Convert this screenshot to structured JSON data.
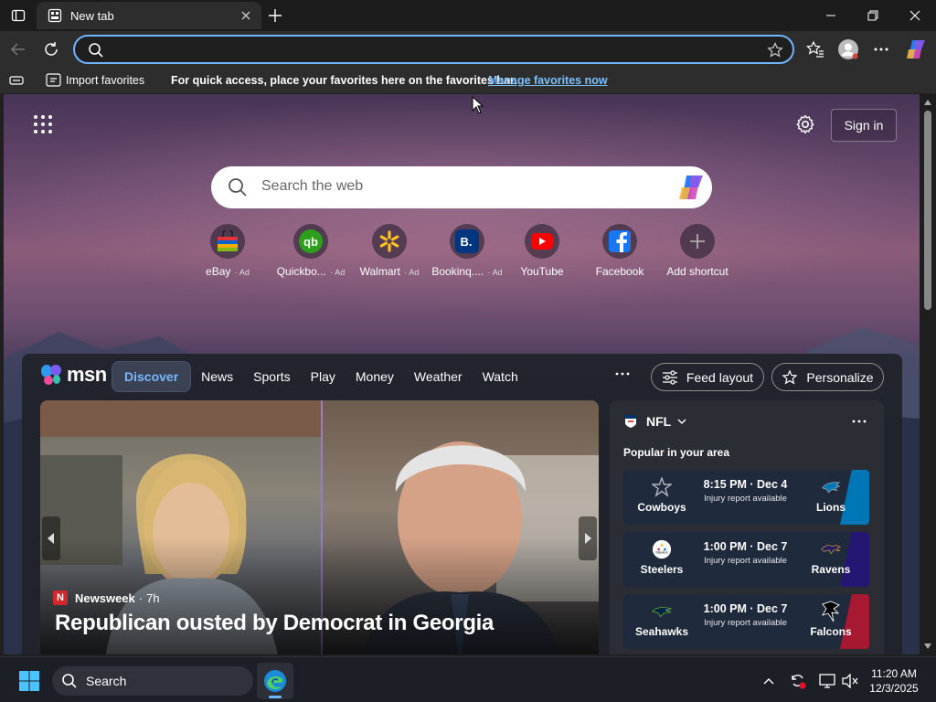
{
  "browser": {
    "tab": {
      "title": "New tab"
    },
    "address_bar": {
      "value": "",
      "placeholder": ""
    },
    "favorites_bar": {
      "import_label": "Import favorites",
      "message": "For quick access, place your favorites here on the favorites bar.",
      "manage_link": "Manage favorites now"
    }
  },
  "new_tab": {
    "sign_in_label": "Sign in",
    "search_placeholder": "Search the web",
    "ad_tag": "Ad",
    "shortcuts": [
      {
        "label": "eBay",
        "ad": true,
        "icon": "ebay-bag-icon"
      },
      {
        "label": "Quickbo...",
        "ad": true,
        "icon": "quickbooks-icon"
      },
      {
        "label": "Walmart",
        "ad": true,
        "icon": "walmart-spark-icon"
      },
      {
        "label": "Bookinq....",
        "ad": true,
        "icon": "booking-icon"
      },
      {
        "label": "YouTube",
        "ad": false,
        "icon": "youtube-icon"
      },
      {
        "label": "Facebook",
        "ad": false,
        "icon": "facebook-icon"
      },
      {
        "label": "Add shortcut",
        "ad": false,
        "icon": "plus-icon"
      }
    ]
  },
  "msn": {
    "logo_text": "msn",
    "nav_tabs": [
      "Discover",
      "News",
      "Sports",
      "Play",
      "Money",
      "Weather",
      "Watch"
    ],
    "active_tab": "Discover",
    "feed_layout_label": "Feed layout",
    "personalize_label": "Personalize",
    "hero": {
      "source": "Newsweek",
      "source_logo_letter": "N",
      "age": "7h",
      "headline": "Republican ousted by Democrat in Georgia"
    },
    "sports": {
      "league": "NFL",
      "subtitle": "Popular in your area",
      "games": [
        {
          "home": "Cowboys",
          "away": "Lions",
          "time": "8:15 PM · Dec 4",
          "note": "Injury report available",
          "home_color": "#1d2a44",
          "away_color": "#0076b6"
        },
        {
          "home": "Steelers",
          "away": "Ravens",
          "time": "1:00 PM · Dec 7",
          "note": "Injury report available",
          "home_color": "#1e2330",
          "away_color": "#241773"
        },
        {
          "home": "Seahawks",
          "away": "Falcons",
          "time": "1:00 PM · Dec 7",
          "note": "Injury report available",
          "home_color": "#1c2c44",
          "away_color": "#a71930"
        }
      ]
    }
  },
  "taskbar": {
    "search_label": "Search",
    "time": "11:20 AM",
    "date": "12/3/2025"
  },
  "colors": {
    "accent": "#6fb4ff",
    "link": "#7cc1ff",
    "msn_active_tab": "#79b8ff"
  }
}
